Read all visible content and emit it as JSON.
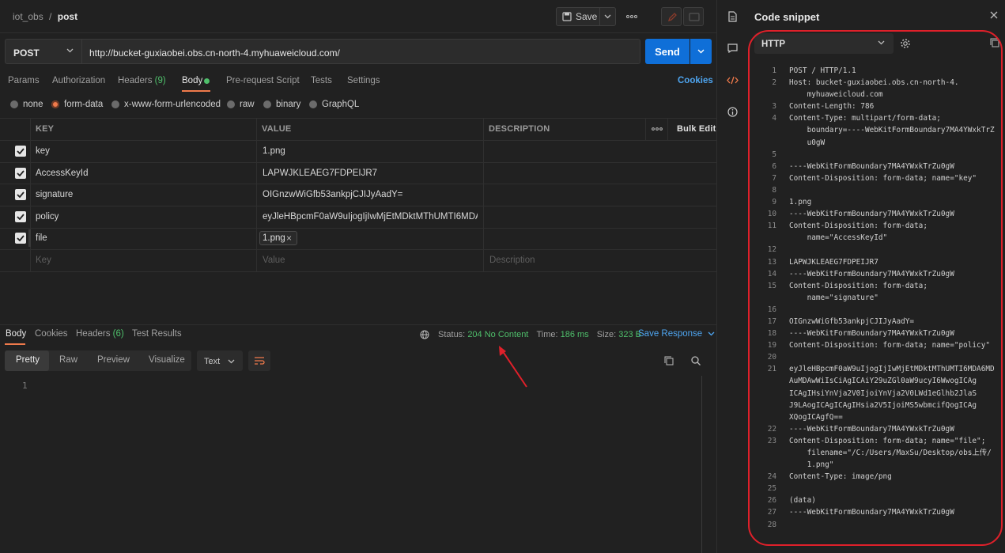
{
  "breadcrumb": {
    "collection": "iot_obs",
    "separator": "/",
    "request": "post"
  },
  "toolbar": {
    "save_label": "Save"
  },
  "request": {
    "method": "POST",
    "url": "http://bucket-guxiaobei.obs.cn-north-4.myhuaweicloud.com/",
    "send_label": "Send"
  },
  "tabs": {
    "params": "Params",
    "authorization": "Authorization",
    "headers": "Headers",
    "headers_count": "(9)",
    "body": "Body",
    "prerequest": "Pre-request Script",
    "tests": "Tests",
    "settings": "Settings",
    "cookies": "Cookies"
  },
  "body_types": [
    "none",
    "form-data",
    "x-www-form-urlencoded",
    "raw",
    "binary",
    "GraphQL"
  ],
  "body_type_selected": "form-data",
  "form_table": {
    "headers": {
      "key": "KEY",
      "value": "VALUE",
      "description": "DESCRIPTION",
      "bulk_edit": "Bulk Edit"
    },
    "rows": [
      {
        "key": "key",
        "value": "1.png"
      },
      {
        "key": "AccessKeyId",
        "value": "LAPWJKLEAEG7FDPEIJR7"
      },
      {
        "key": "signature",
        "value": "OIGnzwWiGfb53ankpjCJIJyAadY="
      },
      {
        "key": "policy",
        "value": "eyJleHBpcmF0aW9uIjogIjIwMjEtMDktMThUMTI6MDA6..."
      },
      {
        "key": "file",
        "value": "1.png"
      }
    ],
    "placeholders": {
      "key": "Key",
      "value": "Value",
      "description": "Description"
    }
  },
  "response": {
    "tabs": {
      "body": "Body",
      "cookies": "Cookies",
      "headers": "Headers",
      "headers_count": "(6)",
      "test_results": "Test Results"
    },
    "status_label": "Status:",
    "status_value": "204 No Content",
    "time_label": "Time:",
    "time_value": "186 ms",
    "size_label": "Size:",
    "size_value": "323 B",
    "save_response": "Save Response",
    "formats": [
      "Pretty",
      "Raw",
      "Preview",
      "Visualize"
    ],
    "text_select": "Text",
    "line_number": "1"
  },
  "code_snippet": {
    "title": "Code snippet",
    "language": "HTTP",
    "lines": [
      {
        "n": "1",
        "t": "POST / HTTP/1.1"
      },
      {
        "n": "2",
        "t": "Host: bucket-guxiaobei.obs.cn-north-4."
      },
      {
        "n": "",
        "t": "    myhuaweicloud.com"
      },
      {
        "n": "3",
        "t": "Content-Length: 786"
      },
      {
        "n": "4",
        "t": "Content-Type: multipart/form-data;"
      },
      {
        "n": "",
        "t": "    boundary=----WebKitFormBoundary7MA4YWxkTrZ"
      },
      {
        "n": "",
        "t": "    u0gW"
      },
      {
        "n": "5",
        "t": ""
      },
      {
        "n": "6",
        "t": "----WebKitFormBoundary7MA4YWxkTrZu0gW"
      },
      {
        "n": "7",
        "t": "Content-Disposition: form-data; name=\"key\""
      },
      {
        "n": "8",
        "t": ""
      },
      {
        "n": "9",
        "t": "1.png"
      },
      {
        "n": "10",
        "t": "----WebKitFormBoundary7MA4YWxkTrZu0gW"
      },
      {
        "n": "11",
        "t": "Content-Disposition: form-data;"
      },
      {
        "n": "",
        "t": "    name=\"AccessKeyId\""
      },
      {
        "n": "12",
        "t": ""
      },
      {
        "n": "13",
        "t": "LAPWJKLEAEG7FDPEIJR7"
      },
      {
        "n": "14",
        "t": "----WebKitFormBoundary7MA4YWxkTrZu0gW"
      },
      {
        "n": "15",
        "t": "Content-Disposition: form-data;"
      },
      {
        "n": "",
        "t": "    name=\"signature\""
      },
      {
        "n": "16",
        "t": ""
      },
      {
        "n": "17",
        "t": "OIGnzwWiGfb53ankpjCJIJyAadY="
      },
      {
        "n": "18",
        "t": "----WebKitFormBoundary7MA4YWxkTrZu0gW"
      },
      {
        "n": "19",
        "t": "Content-Disposition: form-data; name=\"policy\""
      },
      {
        "n": "20",
        "t": ""
      },
      {
        "n": "21",
        "t": "eyJleHBpcmF0aW9uIjogIjIwMjEtMDktMThUMTI6MDA6MD"
      },
      {
        "n": "",
        "t": "AuMDAwWiIsCiAgICAiY29uZGl0aW9ucyI6WwogICAg"
      },
      {
        "n": "",
        "t": "ICAgIHsiYnVja2V0IjoiYnVja2V0LWd1eGlhb2JlaS"
      },
      {
        "n": "",
        "t": "J9LAogICAgICAgIHsia2V5IjoiMS5wbmcifQogICAg"
      },
      {
        "n": "",
        "t": "XQogICAgfQ=="
      },
      {
        "n": "22",
        "t": "----WebKitFormBoundary7MA4YWxkTrZu0gW"
      },
      {
        "n": "23",
        "t": "Content-Disposition: form-data; name=\"file\";"
      },
      {
        "n": "",
        "t": "    filename=\"/C:/Users/MaxSu/Desktop/obs上传/"
      },
      {
        "n": "",
        "t": "    1.png\""
      },
      {
        "n": "24",
        "t": "Content-Type: image/png"
      },
      {
        "n": "25",
        "t": ""
      },
      {
        "n": "26",
        "t": "(data)"
      },
      {
        "n": "27",
        "t": "----WebKitFormBoundary7MA4YWxkTrZu0gW"
      },
      {
        "n": "28",
        "t": ""
      }
    ]
  },
  "colors": {
    "accent": "#ef7a4b",
    "send": "#0f6fd8",
    "success": "#4fbf6b",
    "link": "#4ea5f0",
    "annotation": "#e0202a"
  },
  "icons": [
    "save-icon",
    "chevron-down-icon",
    "more-icon",
    "edit-icon",
    "comment-icon",
    "globe-icon",
    "copy-icon",
    "search-icon",
    "wrap-icon",
    "document-icon",
    "code-icon",
    "info-icon",
    "close-icon",
    "gear-icon",
    "check-icon"
  ]
}
